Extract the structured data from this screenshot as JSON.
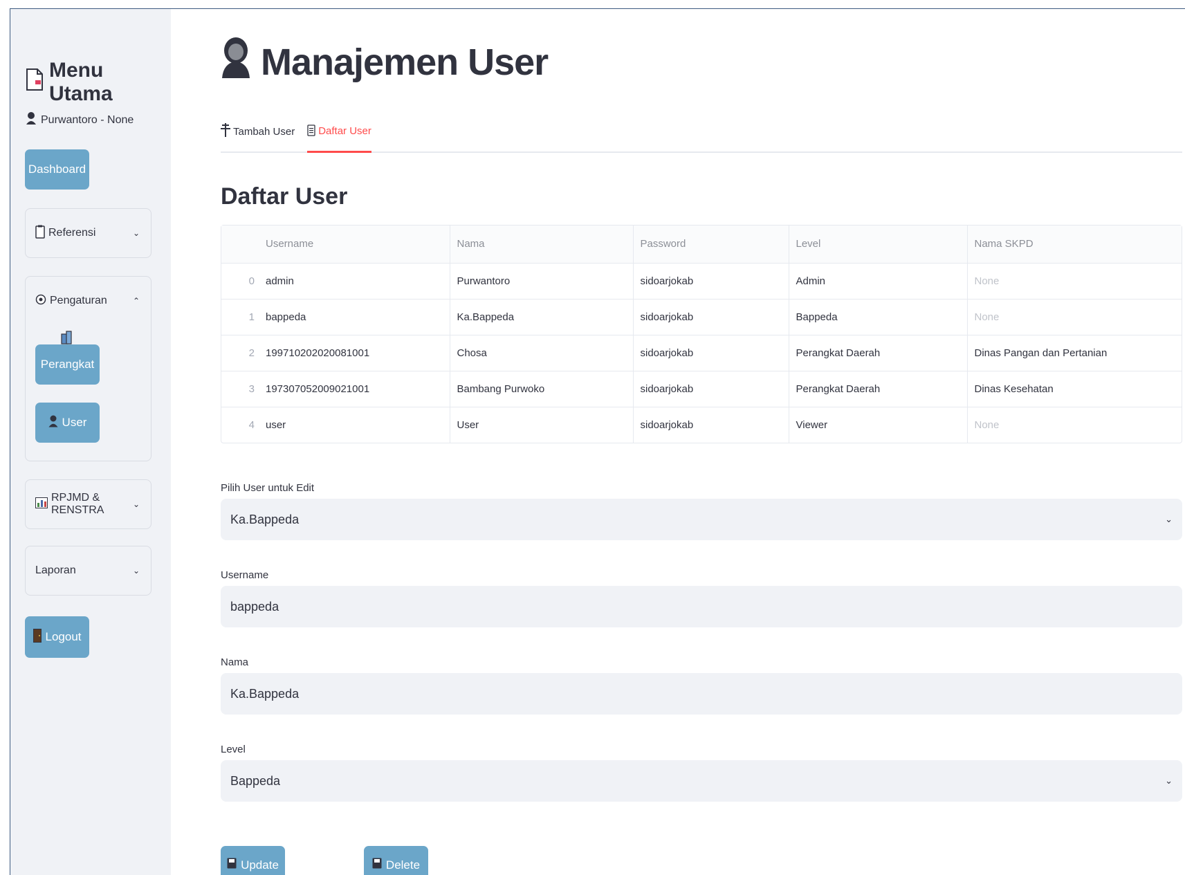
{
  "sidebar": {
    "title": "Menu Utama",
    "user_line": "Purwantoro - None",
    "dashboard_label": "Dashboard",
    "referensi_label": "Referensi",
    "pengaturan_label": "Pengaturan",
    "perangkat_label": "Perangkat",
    "user_label": "User",
    "rpjmd_label": "RPJMD & RENSTRA",
    "laporan_label": "Laporan",
    "logout_label": "Logout"
  },
  "main": {
    "title": "Manajemen User",
    "tabs": [
      {
        "label": "Tambah User"
      },
      {
        "label": "Daftar User"
      }
    ],
    "section_title": "Daftar User",
    "table": {
      "headers": [
        "Username",
        "Nama",
        "Password",
        "Level",
        "Nama SKPD"
      ],
      "rows": [
        {
          "idx": "0",
          "username": "admin",
          "nama": "Purwantoro",
          "password": "sidoarjokab",
          "level": "Admin",
          "skpd": "None"
        },
        {
          "idx": "1",
          "username": "bappeda",
          "nama": "Ka.Bappeda",
          "password": "sidoarjokab",
          "level": "Bappeda",
          "skpd": "None"
        },
        {
          "idx": "2",
          "username": "199710202020081001",
          "nama": "Chosa",
          "password": "sidoarjokab",
          "level": "Perangkat Daerah",
          "skpd": "Dinas Pangan dan Pertanian"
        },
        {
          "idx": "3",
          "username": "197307052009021001",
          "nama": "Bambang Purwoko",
          "password": "sidoarjokab",
          "level": "Perangkat Daerah",
          "skpd": "Dinas Kesehatan"
        },
        {
          "idx": "4",
          "username": "user",
          "nama": "User",
          "password": "sidoarjokab",
          "level": "Viewer",
          "skpd": "None"
        }
      ]
    },
    "form": {
      "select_user_label": "Pilih User untuk Edit",
      "select_user_value": "Ka.Bappeda",
      "username_label": "Username",
      "username_value": "bappeda",
      "nama_label": "Nama",
      "nama_value": "Ka.Bappeda",
      "level_label": "Level",
      "level_value": "Bappeda"
    },
    "update_label": "Update",
    "delete_label": "Delete"
  },
  "colors": {
    "accent": "#ff4b4b",
    "button": "#6ba6c9",
    "sidebar_bg": "#f0f2f6"
  }
}
